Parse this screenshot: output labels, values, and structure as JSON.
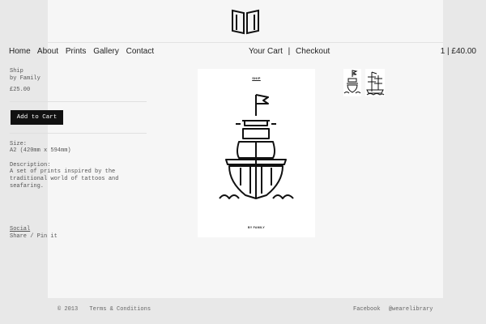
{
  "header": {
    "logo": "book-logo-icon"
  },
  "nav": {
    "items": [
      "Home",
      "About",
      "Prints",
      "Gallery",
      "Contact"
    ]
  },
  "cart": {
    "your_cart": "Your Cart",
    "separator": "|",
    "checkout": "Checkout",
    "summary": "1 | £40.00"
  },
  "product": {
    "name": "Ship",
    "by": "by Family",
    "price": "£25.00",
    "add_to_cart": "Add to Cart",
    "size_label": "Size:",
    "size_value": "A2 (420mm x 594mm)",
    "description_label": "Description:",
    "description": "A set of prints inspired by the traditional world of tattoos and seafaring.",
    "social_label": "Social",
    "share": "Share",
    "share_sep": "/",
    "pin": "Pin it"
  },
  "poster": {
    "title": "SHIP",
    "footer": "BY FAMILY"
  },
  "thumbnails": [
    "ship-thumbnail",
    "ship-side-thumbnail"
  ],
  "footer": {
    "copyright": "© 2013",
    "terms": "Terms & Conditions",
    "facebook": "Facebook",
    "twitter": "@wearelibrary"
  },
  "colors": {
    "background": "#e8e8e8",
    "page": "#f6f6f6",
    "button": "#111111"
  }
}
